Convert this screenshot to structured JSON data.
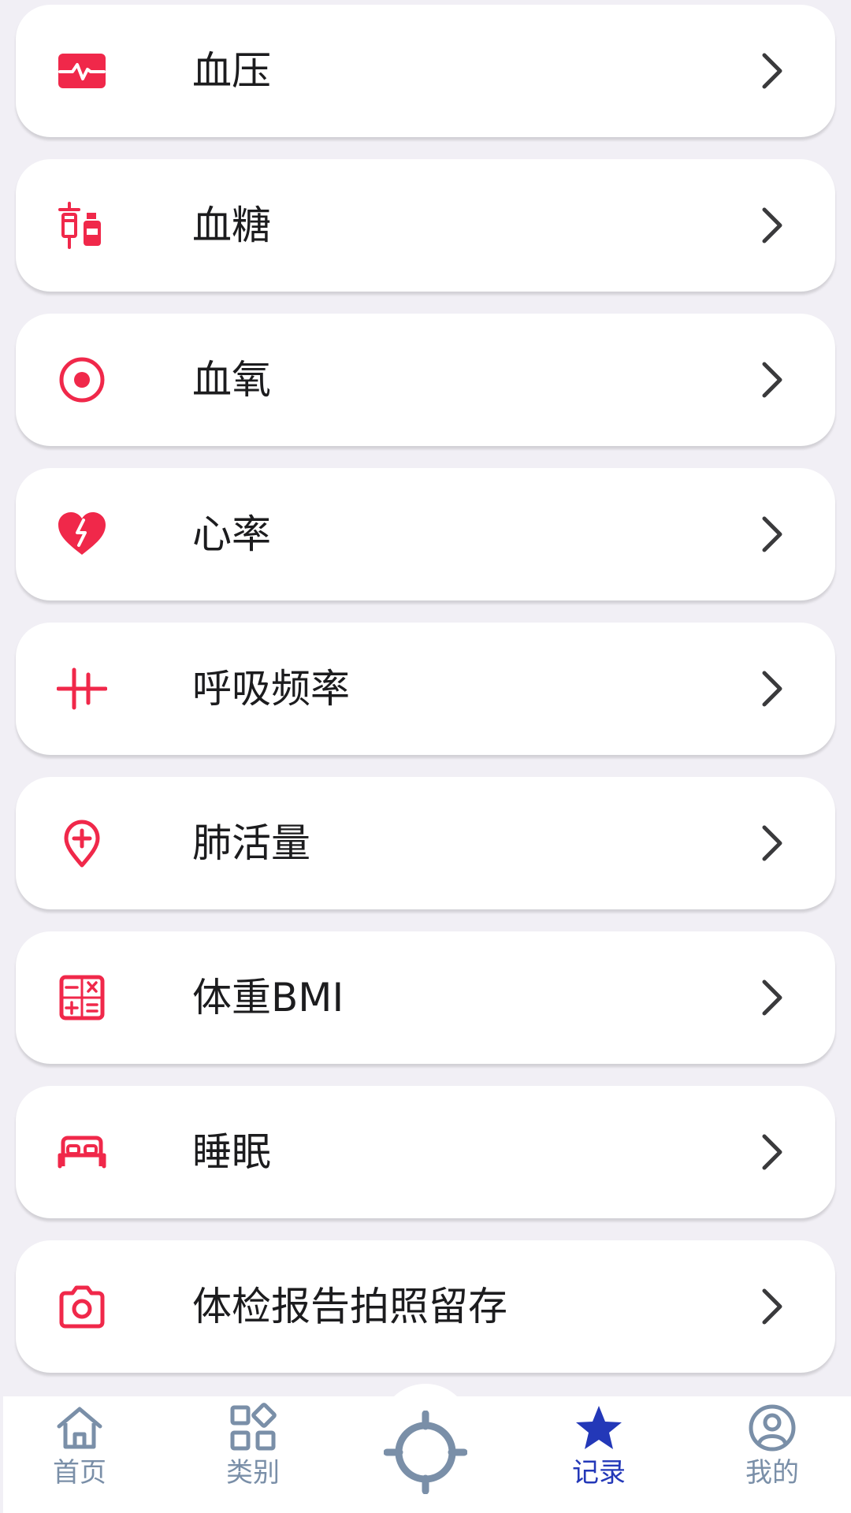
{
  "colors": {
    "accent": "#f0284a",
    "chevron": "#3a3a3c",
    "tab_inactive": "#7a8fa8",
    "tab_active": "#2338b8",
    "background": "#f1eff5"
  },
  "menu": {
    "items": [
      {
        "label": "血压",
        "icon": "blood-pressure-icon"
      },
      {
        "label": "血糖",
        "icon": "blood-sugar-icon"
      },
      {
        "label": "血氧",
        "icon": "blood-oxygen-icon"
      },
      {
        "label": "心率",
        "icon": "heart-rate-icon"
      },
      {
        "label": "呼吸频率",
        "icon": "respiration-icon"
      },
      {
        "label": "肺活量",
        "icon": "lung-capacity-icon"
      },
      {
        "label": "体重BMI",
        "icon": "calculator-icon"
      },
      {
        "label": "睡眠",
        "icon": "bed-icon"
      },
      {
        "label": "体检报告拍照留存",
        "icon": "camera-icon"
      }
    ]
  },
  "tabbar": {
    "home_label": "首页",
    "category_label": "类别",
    "record_label": "记录",
    "mine_label": "我的",
    "active_tab": "记录"
  }
}
